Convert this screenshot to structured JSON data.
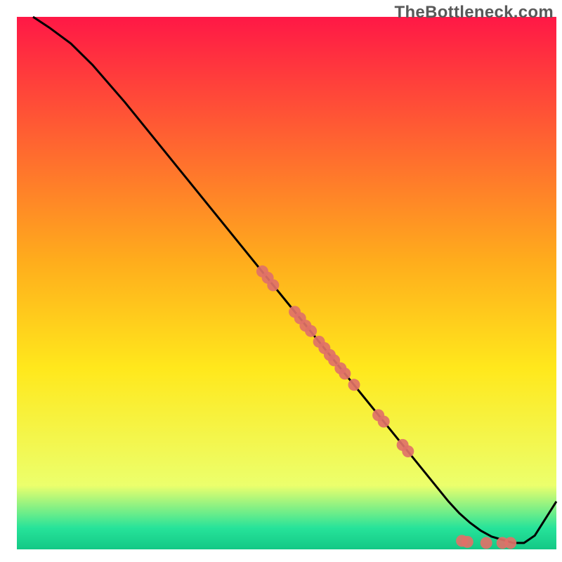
{
  "watermark": "TheBottleneck.com",
  "colors": {
    "dot_fill": "#e07168",
    "dot_stroke": "#b84e46",
    "line": "#000000",
    "grad_top": "#ff1846",
    "grad_upper_mid": "#ffad1c",
    "grad_mid": "#ffe81c",
    "grad_lower_mid": "#ecff6c",
    "grad_green": "#26e39a",
    "grad_bottom": "#14c885"
  },
  "chart_data": {
    "type": "line",
    "title": "",
    "xlabel": "",
    "ylabel": "",
    "xlim": [
      0,
      100
    ],
    "ylim": [
      0,
      100
    ],
    "series": [
      {
        "name": "curve",
        "x": [
          3,
          6,
          10,
          14,
          20,
          28,
          36,
          44,
          52,
          60,
          68,
          76,
          80,
          82,
          84,
          86,
          88,
          92,
          94,
          96,
          100
        ],
        "y": [
          100,
          98,
          95,
          91,
          84,
          74,
          64,
          54,
          44,
          34,
          24,
          14,
          9,
          6.8,
          5,
          3.5,
          2.4,
          1.2,
          1.2,
          2.6,
          9
        ]
      }
    ],
    "scatter": [
      {
        "x": 45.5,
        "y": 52.2
      },
      {
        "x": 46.5,
        "y": 51.0
      },
      {
        "x": 47.5,
        "y": 49.6
      },
      {
        "x": 51.5,
        "y": 44.6
      },
      {
        "x": 52.5,
        "y": 43.4
      },
      {
        "x": 53.5,
        "y": 42.0
      },
      {
        "x": 54.5,
        "y": 41.0
      },
      {
        "x": 56.0,
        "y": 39.0
      },
      {
        "x": 57.0,
        "y": 37.8
      },
      {
        "x": 58.0,
        "y": 36.5
      },
      {
        "x": 58.8,
        "y": 35.5
      },
      {
        "x": 60.0,
        "y": 34.0
      },
      {
        "x": 60.8,
        "y": 33.0
      },
      {
        "x": 62.5,
        "y": 30.9
      },
      {
        "x": 67.0,
        "y": 25.2
      },
      {
        "x": 68.0,
        "y": 24.0
      },
      {
        "x": 71.5,
        "y": 19.6
      },
      {
        "x": 72.5,
        "y": 18.4
      },
      {
        "x": 82.5,
        "y": 1.6
      },
      {
        "x": 83.5,
        "y": 1.4
      },
      {
        "x": 87.0,
        "y": 1.2
      },
      {
        "x": 90.0,
        "y": 1.2
      },
      {
        "x": 91.5,
        "y": 1.2
      }
    ]
  }
}
